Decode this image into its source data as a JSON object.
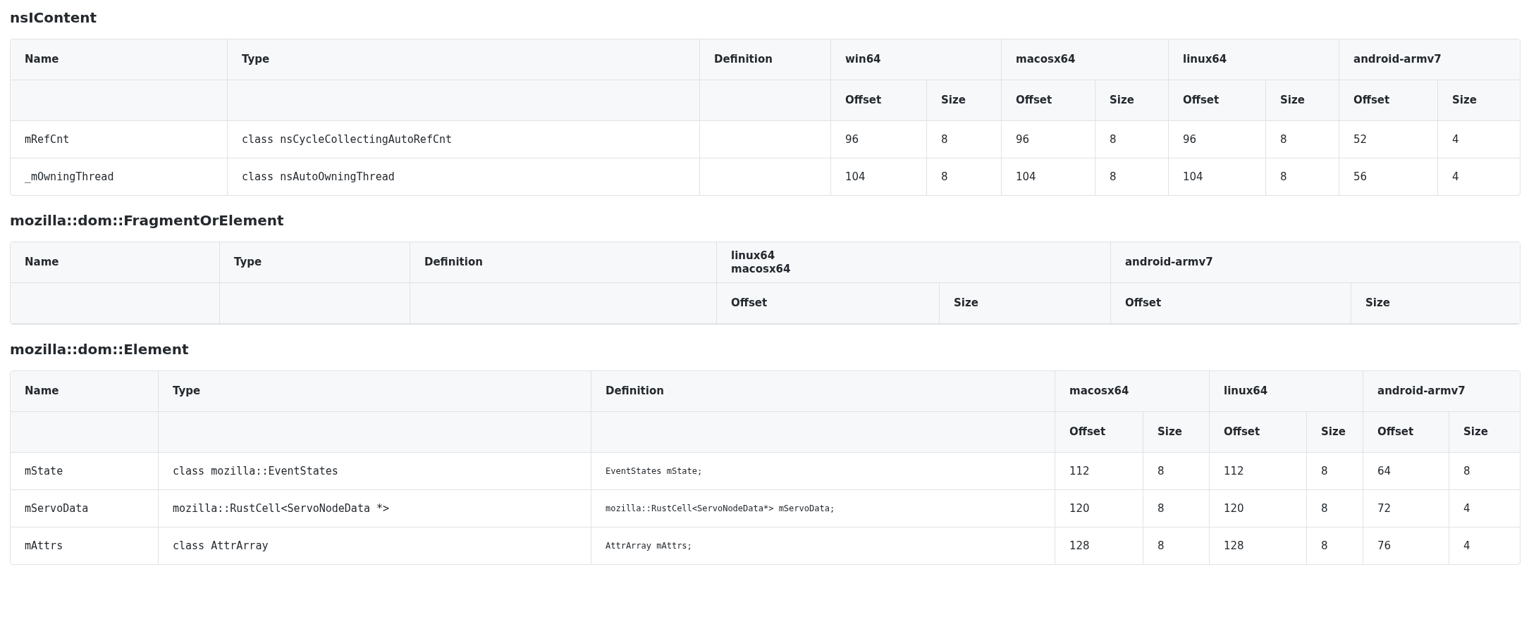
{
  "sections": [
    {
      "title": "nsIContent",
      "columns": [
        "Name",
        "Type",
        "Definition"
      ],
      "platforms": [
        {
          "labels": [
            "win64"
          ],
          "subcolumns": [
            "Offset",
            "Size"
          ]
        },
        {
          "labels": [
            "macosx64"
          ],
          "subcolumns": [
            "Offset",
            "Size"
          ]
        },
        {
          "labels": [
            "linux64"
          ],
          "subcolumns": [
            "Offset",
            "Size"
          ]
        },
        {
          "labels": [
            "android-armv7"
          ],
          "subcolumns": [
            "Offset",
            "Size"
          ]
        }
      ],
      "rows": [
        {
          "name": "mRefCnt",
          "type": "class nsCycleCollectingAutoRefCnt",
          "values": [
            "96",
            "8",
            "96",
            "8",
            "96",
            "8",
            "52",
            "4"
          ]
        },
        {
          "name": "_mOwningThread",
          "type": "class nsAutoOwningThread",
          "values": [
            "104",
            "8",
            "104",
            "8",
            "104",
            "8",
            "56",
            "4"
          ]
        }
      ]
    },
    {
      "title": "mozilla::dom::FragmentOrElement",
      "columns": [
        "Name",
        "Type",
        "Definition"
      ],
      "platforms": [
        {
          "labels": [
            "linux64",
            "macosx64"
          ],
          "subcolumns": [
            "Offset",
            "Size"
          ]
        },
        {
          "labels": [
            "android-armv7"
          ],
          "subcolumns": [
            "Offset",
            "Size"
          ]
        }
      ]
    },
    {
      "title": "mozilla::dom::Element",
      "columns": [
        "Name",
        "Type",
        "Definition"
      ],
      "platforms": [
        {
          "labels": [
            "macosx64"
          ],
          "subcolumns": [
            "Offset",
            "Size"
          ]
        },
        {
          "labels": [
            "linux64"
          ],
          "subcolumns": [
            "Offset",
            "Size"
          ]
        },
        {
          "labels": [
            "android-armv7"
          ],
          "subcolumns": [
            "Offset",
            "Size"
          ]
        }
      ],
      "rows": [
        {
          "name": "mState",
          "type": "class mozilla::EventStates",
          "definition": "EventStates mState;",
          "values": [
            "112",
            "8",
            "112",
            "8",
            "64",
            "8"
          ]
        },
        {
          "name": "mServoData",
          "type": "mozilla::RustCell<ServoNodeData *>",
          "definition": "mozilla::RustCell<ServoNodeData*> mServoData;",
          "values": [
            "120",
            "8",
            "120",
            "8",
            "72",
            "4"
          ]
        },
        {
          "name": "mAttrs",
          "type": "class AttrArray",
          "definition": "AttrArray mAttrs;",
          "values": [
            "128",
            "8",
            "128",
            "8",
            "76",
            "4"
          ]
        }
      ]
    }
  ]
}
